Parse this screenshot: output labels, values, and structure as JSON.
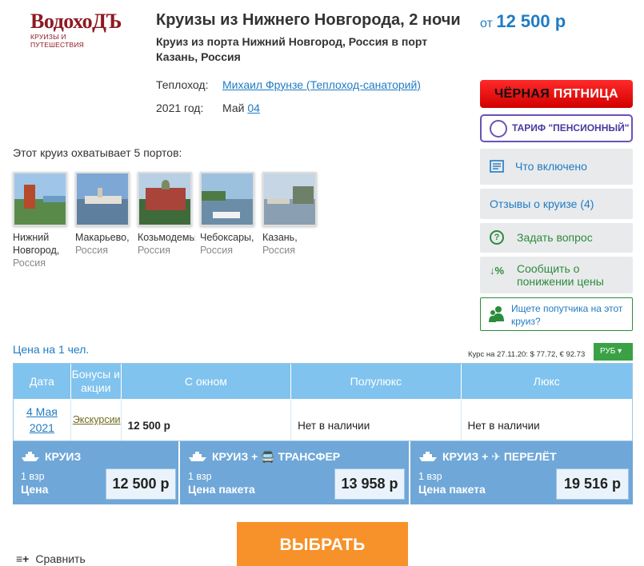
{
  "logo": {
    "brand": "ВодохоДЪ",
    "tagline": "КРУИЗЫ И ПУТЕШЕСТВИЯ"
  },
  "header": {
    "title": "Круизы из Нижнего Новгорода, 2 ночи",
    "subtitle": "Круиз из порта Нижний Новгород, Россия в порт Казань, Россия",
    "price_from": "от",
    "price_value": "12 500 р"
  },
  "info": {
    "ship_label": "Теплоход:",
    "ship_name": "Михаил Фрунзе (Теплоход-санаторий)",
    "year_label": "2021 год:",
    "month": "Май",
    "day": "04"
  },
  "side": {
    "black_friday_dark": "ЧЁРНАЯ",
    "black_friday_white": "ПЯТНИЦА",
    "pension": "ТАРИФ \"ПЕНСИОННЫЙ\"",
    "included": "Что включено",
    "reviews": "Отзывы о круизе (4)",
    "ask": "Задать вопрос",
    "ask_icon": "?",
    "drop_icon": "↓%",
    "price_drop": "Сообщить о понижении цены",
    "companion": "Ищете попутчика на этот круиз?"
  },
  "ports": {
    "title": "Этот круиз охватывает 5 портов:",
    "items": [
      {
        "name": "Нижний",
        "name2": "Новгород,",
        "country": "Россия"
      },
      {
        "name": "Макарьево,",
        "country": "Россия"
      },
      {
        "name": "Козьмодемьянск,",
        "country": "Россия"
      },
      {
        "name": "Чебоксары,",
        "country": "Россия"
      },
      {
        "name": "Казань,",
        "country": "Россия"
      }
    ]
  },
  "pricing": {
    "per_person": "Цена на 1 чел.",
    "rate": "Курс на 27.11.20: $ 77.72, € 92.73",
    "currency": "РУБ ▾",
    "headers": [
      "Дата",
      "Бонусы и акции",
      "С окном",
      "Полулюкс",
      "Люкс"
    ],
    "row": {
      "date_day": "4 Мая",
      "date_year": "2021",
      "bonus": "Экскурсии",
      "window": "12 500 р",
      "semilux": "Нет в наличии",
      "lux": "Нет в наличии"
    }
  },
  "packages": [
    {
      "title": "КРУИЗ",
      "persons": "1 взр",
      "label": "Цена",
      "price": "12 500 р"
    },
    {
      "title": "КРУИЗ + 🚍 ТРАНСФЕР",
      "persons": "1 взр",
      "label": "Цена пакета",
      "price": "13 958 р"
    },
    {
      "title": "КРУИЗ + ✈ ПЕРЕЛЁТ",
      "persons": "1 взр",
      "label": "Цена пакета",
      "price": "19 516 р"
    }
  ],
  "actions": {
    "choose": "ВЫБРАТЬ",
    "compare": "Сравнить",
    "compare_icon": "≡+"
  },
  "colors": {
    "accent_blue": "#1f7cc4",
    "header_blue": "#80c3ee",
    "package_blue": "#6fa7d8",
    "orange": "#f7922a",
    "green": "#2c8c3c",
    "brand_red": "#8e1a22"
  }
}
